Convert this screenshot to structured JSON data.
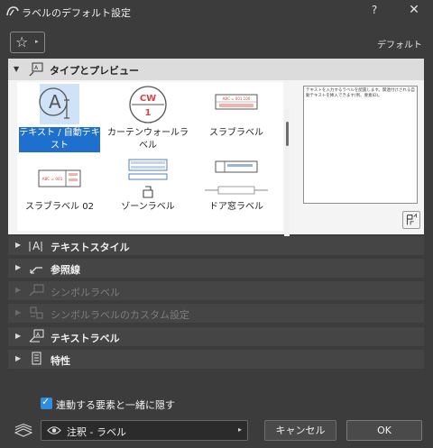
{
  "window": {
    "title": "ラベルのデフォルト設定",
    "help_label": "?",
    "close_label": "✕"
  },
  "favorites": {
    "icon": "star-icon",
    "arrow": "▸"
  },
  "default_label": "デフォルト",
  "type_preview_panel": {
    "title": "タイプとプレビュー",
    "tiles": [
      {
        "label": "テキスト / 自動テキスト",
        "selected": true
      },
      {
        "label": "カーテンウォールラベル",
        "cw_top": "CW",
        "cw_bottom": "1"
      },
      {
        "label": "スラブラベル",
        "tag_text": "ABC = 001  100"
      },
      {
        "label": "スラブラベル 02",
        "tag_text": "ABC = 001"
      },
      {
        "label": "ゾーンラベル"
      },
      {
        "label": "ドア窓ラベル"
      }
    ],
    "preview_text": "テキストを入力するラベルを配置します。関連付けされる自動テキストを挿入できます(例、要素ID)。"
  },
  "panels": [
    {
      "title": "テキストスタイル",
      "icon": "text-style-icon",
      "enabled": true
    },
    {
      "title": "参照線",
      "icon": "pointer-line-icon",
      "enabled": true
    },
    {
      "title": "シンボルラベル",
      "icon": "symbol-label-icon",
      "enabled": false
    },
    {
      "title": "シンボルラベルのカスタム設定",
      "icon": "custom-settings-icon",
      "enabled": false
    },
    {
      "title": "テキストラベル",
      "icon": "text-label-icon",
      "enabled": true
    },
    {
      "title": "特性",
      "icon": "properties-icon",
      "enabled": true
    }
  ],
  "hide_with_element": {
    "label": "連動する要素と一緒に隠す",
    "checked": true
  },
  "layer": {
    "value": "注釈 - ラベル",
    "arrow": "▸"
  },
  "buttons": {
    "cancel": "キャンセル",
    "ok": "OK"
  },
  "colors": {
    "accent": "#1e6fce",
    "checkbox": "#2f8de0",
    "tag_red": "#d64545"
  }
}
